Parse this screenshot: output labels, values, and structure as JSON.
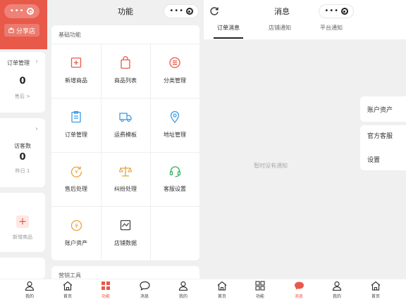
{
  "colors": {
    "accent": "#e8594a",
    "background": "#f0f0f0",
    "card": "#ffffff"
  },
  "left_panel": {
    "share_label": "分享店",
    "orders_card": {
      "title": "订单管理",
      "value": "0",
      "sub": "售后 >"
    },
    "visitors_card": {
      "title": "访客数",
      "value": "0",
      "sub": "昨日 1"
    },
    "add_product_label": "新增商品"
  },
  "functions_panel": {
    "title": "功能",
    "section_title": "基础功能",
    "items": [
      {
        "label": "新增商品",
        "icon": "add-square-icon"
      },
      {
        "label": "商品列表",
        "icon": "shopping-bag-icon"
      },
      {
        "label": "分类管理",
        "icon": "list-circle-icon"
      },
      {
        "label": "订单管理",
        "icon": "clipboard-icon"
      },
      {
        "label": "运费模板",
        "icon": "truck-icon"
      },
      {
        "label": "地址管理",
        "icon": "location-pin-icon"
      },
      {
        "label": "售后处理",
        "icon": "refund-icon"
      },
      {
        "label": "纠纷处理",
        "icon": "scale-icon"
      },
      {
        "label": "客服设置",
        "icon": "headset-icon"
      },
      {
        "label": "账户资产",
        "icon": "coin-icon"
      },
      {
        "label": "店铺数据",
        "icon": "chart-icon"
      }
    ],
    "next_section_title": "营销工具"
  },
  "messages_panel": {
    "title": "消息",
    "tabs": [
      {
        "label": "订单消息",
        "active": true
      },
      {
        "label": "店铺通知",
        "active": false
      },
      {
        "label": "平台通知",
        "active": false
      }
    ],
    "empty_text": "暂时没有通知",
    "side_menu": {
      "assets": "账户资产",
      "service": "官方客服",
      "settings": "设置"
    }
  },
  "tabbar": {
    "items": [
      {
        "label": "我的",
        "icon": "person-icon",
        "active": false
      },
      {
        "label": "首页",
        "icon": "home-icon",
        "active": false
      },
      {
        "label": "功能",
        "icon": "grid-icon",
        "active": true
      },
      {
        "label": "消息",
        "icon": "chat-icon",
        "active": false
      },
      {
        "label": "我的",
        "icon": "person-icon",
        "active": false
      },
      {
        "label": "首页",
        "icon": "home-icon",
        "active": false
      },
      {
        "label": "功能",
        "icon": "grid-icon",
        "active": false
      },
      {
        "label": "消息",
        "icon": "chat-icon",
        "active": true
      },
      {
        "label": "我的",
        "icon": "person-icon",
        "active": false
      },
      {
        "label": "首页",
        "icon": "home-icon",
        "active": false
      }
    ]
  }
}
